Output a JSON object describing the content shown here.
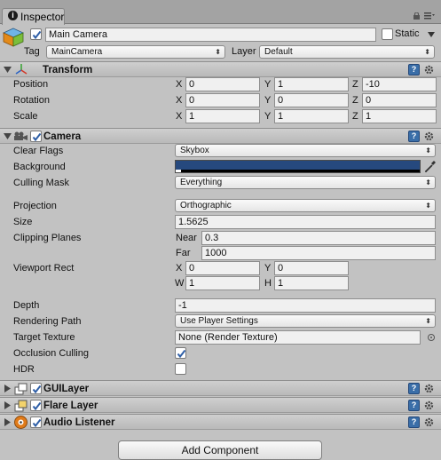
{
  "window": {
    "tab_label": "Inspector"
  },
  "gameobject": {
    "name": "Main Camera",
    "static_label": "Static",
    "tag_label": "Tag",
    "tag_value": "MainCamera",
    "layer_label": "Layer",
    "layer_value": "Default"
  },
  "transform": {
    "title": "Transform",
    "rows": [
      {
        "label": "Position",
        "x": "0",
        "y": "1",
        "z": "-10"
      },
      {
        "label": "Rotation",
        "x": "0",
        "y": "0",
        "z": "0"
      },
      {
        "label": "Scale",
        "x": "1",
        "y": "1",
        "z": "1"
      }
    ],
    "x_label": "X",
    "y_label": "Y",
    "z_label": "Z"
  },
  "camera": {
    "title": "Camera",
    "clear_flags_label": "Clear Flags",
    "clear_flags_value": "Skybox",
    "background_label": "Background",
    "background_color": "#26497e",
    "culling_mask_label": "Culling Mask",
    "culling_mask_value": "Everything",
    "projection_label": "Projection",
    "projection_value": "Orthographic",
    "size_label": "Size",
    "size_value": "1.5625",
    "clipping_label": "Clipping Planes",
    "near_label": "Near",
    "near_value": "0.3",
    "far_label": "Far",
    "far_value": "1000",
    "viewport_label": "Viewport Rect",
    "vp_x_label": "X",
    "vp_x": "0",
    "vp_y_label": "Y",
    "vp_y": "0",
    "vp_w_label": "W",
    "vp_w": "1",
    "vp_h_label": "H",
    "vp_h": "1",
    "depth_label": "Depth",
    "depth_value": "-1",
    "rendering_path_label": "Rendering Path",
    "rendering_path_value": "Use Player Settings",
    "target_texture_label": "Target Texture",
    "target_texture_value": "None (Render Texture)",
    "occlusion_label": "Occlusion Culling",
    "occlusion_checked": true,
    "hdr_label": "HDR",
    "hdr_checked": false
  },
  "components": [
    {
      "title": "GUILayer",
      "icon": "guilayer-icon"
    },
    {
      "title": "Flare Layer",
      "icon": "flare-layer-icon"
    },
    {
      "title": "Audio Listener",
      "icon": "audio-listener-icon"
    }
  ],
  "add_component_label": "Add Component",
  "colors": {
    "accent": "#3a6ea8",
    "panel": "#c2c2c2",
    "header": "#a3a3a3"
  }
}
